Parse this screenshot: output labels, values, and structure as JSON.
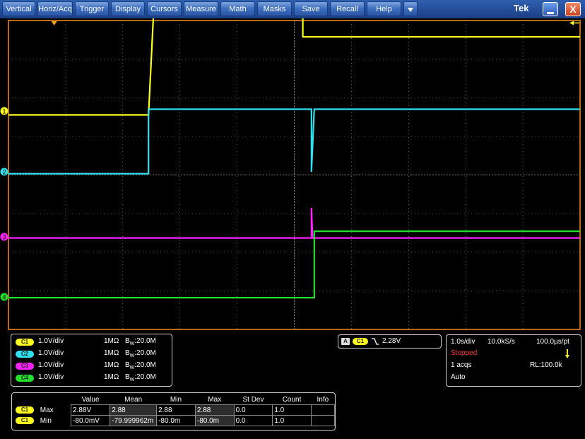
{
  "menu": {
    "items": [
      "Vertical",
      "Horiz/Acq",
      "Trigger",
      "Display",
      "Cursors",
      "Measure",
      "Math",
      "Masks",
      "Save",
      "Recall",
      "Help"
    ],
    "dropdown_icon": "triangle-down-icon",
    "brand": "Tek",
    "minimize_icon": "minimize-icon",
    "close_label": "X"
  },
  "colors": {
    "ch1": "#ffff1e",
    "ch2": "#2fe0f0",
    "ch3": "#ff20ff",
    "ch4": "#23e02b",
    "frame": "#b86a14",
    "grid": "#9a9a9a"
  },
  "markers": {
    "ch1": "1",
    "ch2": "2",
    "ch3": "3",
    "ch4": "4"
  },
  "channels": [
    {
      "badge": "C1",
      "scale": "1.0V/div",
      "impedance": "1MΩ",
      "bw_prefix": "B",
      "bw_sub": "W",
      "bw": ":20.0M"
    },
    {
      "badge": "C2",
      "scale": "1.0V/div",
      "impedance": "1MΩ",
      "bw_prefix": "B",
      "bw_sub": "W",
      "bw": ":20.0M"
    },
    {
      "badge": "C3",
      "scale": "1.0V/div",
      "impedance": "1MΩ",
      "bw_prefix": "B",
      "bw_sub": "W",
      "bw": ":20.0M"
    },
    {
      "badge": "C4",
      "scale": "1.0V/div",
      "impedance": "1MΩ",
      "bw_prefix": "B",
      "bw_sub": "W",
      "bw": ":20.0M"
    }
  ],
  "trigger": {
    "badge_a": "A",
    "badge_ch": "C1",
    "slope_icon": "falling-edge-icon",
    "level": "2.28V"
  },
  "timebase": {
    "scale": "1.0s/div",
    "sample_rate": "10.0kS/s",
    "resolution": "100.0µs/pt",
    "state": "Stopped",
    "acqs": "1 acqs",
    "record_length": "RL:100.0k",
    "mode": "Auto"
  },
  "measurements": {
    "headers": [
      "Value",
      "Mean",
      "Min",
      "Max",
      "St Dev",
      "Count",
      "Info"
    ],
    "rows": [
      {
        "badge": "C1",
        "label": "Max",
        "cells": [
          "2.88V",
          "2.88",
          "2.88",
          "2.88",
          "0.0",
          "1.0",
          ""
        ]
      },
      {
        "badge": "C1",
        "label": "Min",
        "cells": [
          "-80.0mV",
          "-79.999962m",
          "-80.0m",
          "-80.0m",
          "0.0",
          "1.0",
          ""
        ]
      }
    ]
  },
  "waveforms": {
    "time_divisions": 10,
    "volt_divisions": 8,
    "ch1_volts": [
      [
        0,
        -0.1
      ],
      [
        2.45,
        -0.1
      ],
      [
        2.55,
        2.88
      ],
      [
        5.15,
        2.88
      ],
      [
        5.15,
        1.92
      ],
      [
        10,
        1.92
      ]
    ],
    "ch2_volts": [
      [
        0,
        -0.05
      ],
      [
        2.45,
        -0.05
      ],
      [
        2.45,
        1.62
      ],
      [
        5.3,
        1.62
      ],
      [
        5.3,
        0.0
      ],
      [
        5.35,
        1.62
      ],
      [
        10,
        1.62
      ]
    ],
    "ch3_volts": [
      [
        0,
        -0.03
      ],
      [
        5.3,
        -0.03
      ],
      [
        5.3,
        0.75
      ],
      [
        5.32,
        -0.03
      ],
      [
        10,
        -0.03
      ]
    ],
    "ch4_volts": [
      [
        0,
        -0.02
      ],
      [
        5.35,
        -0.02
      ],
      [
        5.35,
        1.7
      ],
      [
        10,
        1.7
      ]
    ]
  }
}
